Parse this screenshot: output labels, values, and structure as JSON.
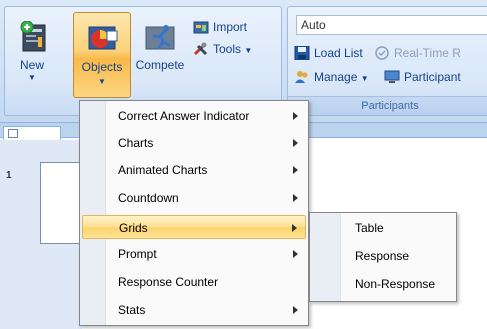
{
  "ribbon": {
    "new_label": "New",
    "objects_label": "Objects",
    "compete_label": "Compete",
    "import_label": "Import",
    "tools_label": "Tools",
    "auto_value": "Auto",
    "load_list_label": "Load List",
    "realtime_label": "Real-Time R",
    "manage_label": "Manage",
    "participant_label": "Participant",
    "participants_group": "Participants"
  },
  "slides": {
    "slide_number": "1"
  },
  "menu": {
    "items": [
      {
        "label": "Correct Answer Indicator",
        "submenu": true
      },
      {
        "label": "Charts",
        "submenu": true
      },
      {
        "label": "Animated Charts",
        "submenu": true
      },
      {
        "label": "Countdown",
        "submenu": true
      },
      {
        "label": "Grids",
        "submenu": true,
        "highlighted": true
      },
      {
        "label": "Prompt",
        "submenu": true
      },
      {
        "label": "Response Counter",
        "submenu": false
      },
      {
        "label": "Stats",
        "submenu": true
      }
    ]
  },
  "submenu": {
    "items": [
      {
        "label": "Table"
      },
      {
        "label": "Response"
      },
      {
        "label": "Non-Response"
      }
    ]
  },
  "colors": {
    "accent": "#fbd36b",
    "ribbon_text": "#15428b",
    "ribbon_bg": "#cfe0f5"
  }
}
